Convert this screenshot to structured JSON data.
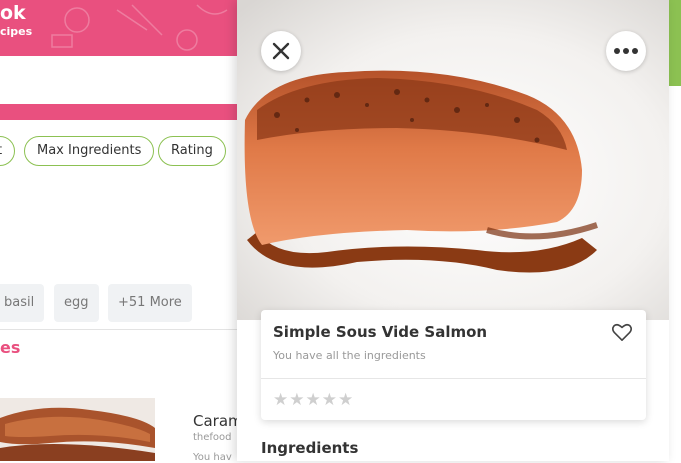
{
  "app": {
    "brand_fragment": "ok",
    "brand_sub_fragment": "cipes"
  },
  "filters": {
    "chips": [
      "t",
      "Max Ingredients",
      "Rating"
    ]
  },
  "ingredient_pills": [
    "basil",
    "egg",
    "+51 More"
  ],
  "section": {
    "title_fragment": "es"
  },
  "list_item": {
    "title_fragment": "Caram",
    "source_fragment": "thefood",
    "sub_fragment": "You hav"
  },
  "recipe": {
    "title": "Simple Sous Vide Salmon",
    "subtitle": "You have all the ingredients",
    "rating_stars": "★★★★★",
    "rating_value": 0,
    "ingredients_heading": "Ingredients"
  },
  "icons": {
    "close": "close-icon",
    "more": "more-icon",
    "favorite": "heart-icon"
  },
  "colors": {
    "brand_pink": "#e9507f",
    "accent_green": "#8cc152"
  }
}
